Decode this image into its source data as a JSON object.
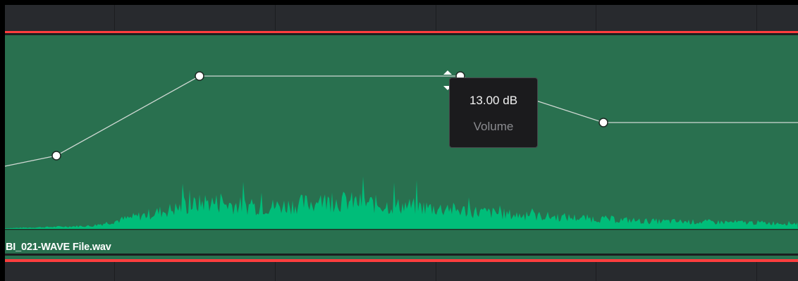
{
  "clip": {
    "name": "BI_021-WAVE File.wav"
  },
  "tooltip": {
    "value": "13.00 dB",
    "parameter": "Volume"
  },
  "colors": {
    "clip_fill": "#29704f",
    "clip_border": "#ff3e3e",
    "waveform": "#00bd79",
    "curve": "#cfd8d3",
    "keyframe_fill": "#ffffff",
    "keyframe_stroke": "#1e2a24",
    "tooltip_bg": "#1b1b1d"
  },
  "icons": {
    "keyframe": "circle-icon",
    "drag_handle": "up-down-arrow-icon"
  }
}
